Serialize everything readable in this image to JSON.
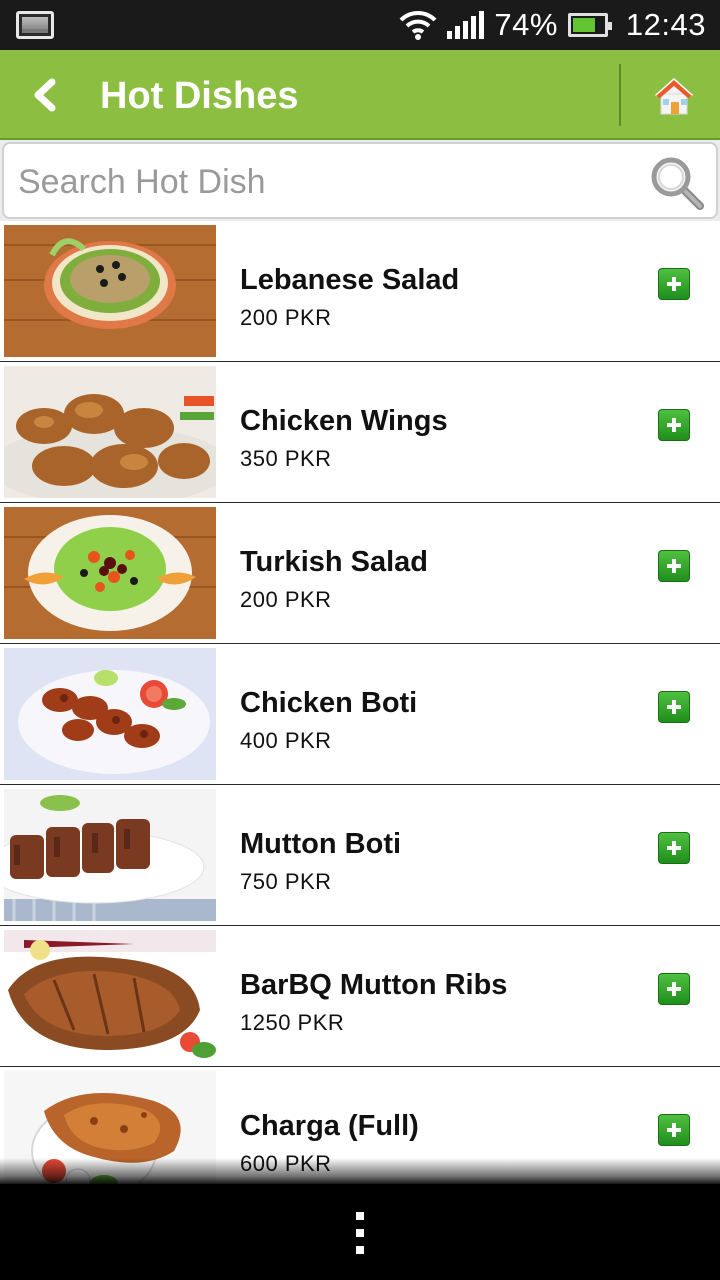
{
  "status_bar": {
    "battery": "74%",
    "battery_level": 0.74,
    "time": "12:43",
    "icons": [
      "notification-icon",
      "wifi-icon",
      "signal-icon",
      "battery-icon"
    ]
  },
  "header": {
    "title": "Hot Dishes",
    "back_icon": "back-arrow-icon",
    "home_icon": "home-icon",
    "accent": "#8cbe41"
  },
  "search": {
    "placeholder": "Search Hot Dish",
    "value": "",
    "icon": "search-icon"
  },
  "dishes": [
    {
      "name": "Lebanese Salad",
      "price": "200 PKR"
    },
    {
      "name": "Chicken Wings",
      "price": "350 PKR"
    },
    {
      "name": "Turkish Salad",
      "price": "200 PKR"
    },
    {
      "name": "Chicken Boti",
      "price": "400 PKR"
    },
    {
      "name": "Mutton Boti",
      "price": "750 PKR"
    },
    {
      "name": "BarBQ Mutton Ribs",
      "price": "1250 PKR"
    },
    {
      "name": "Charga (Full)",
      "price": "600 PKR"
    }
  ],
  "add_icon": "add-plus-icon",
  "nav": {
    "menu_icon": "overflow-menu-icon"
  }
}
